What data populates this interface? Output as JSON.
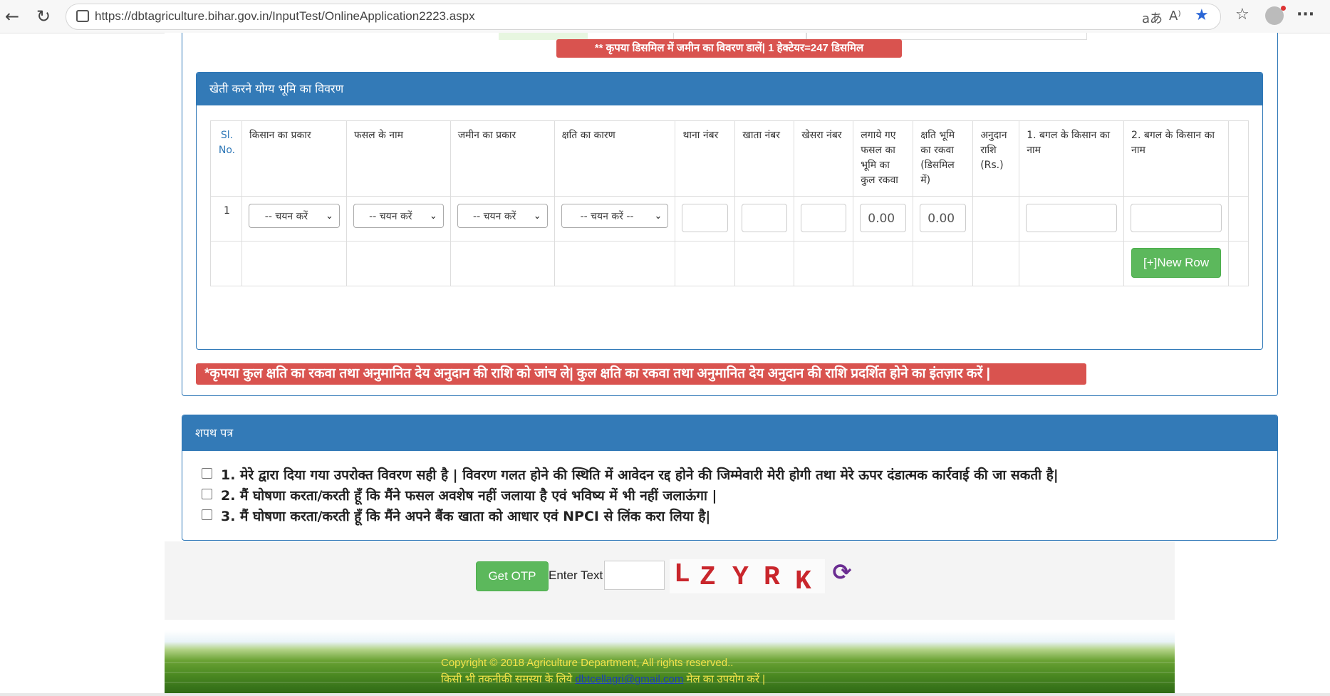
{
  "browser": {
    "url": "https://dbtagriculture.bihar.gov.in/InputTest/OnlineApplication2223.aspx",
    "back_glyph": "←",
    "reload_glyph": "↻",
    "translate_glyph": "aあ",
    "read_aloud_glyph": "A⁾",
    "favorite_glyph": "★",
    "favorites_glyph": "☆",
    "menu_glyph": "···"
  },
  "top_note": "** कृपया डिसमिल में जमीन का विवरण डालें| 1 हेक्टेयर=247 डिसमिल",
  "land_panel": {
    "title": "खेती करने योग्य भूमि का विवरण",
    "headers": [
      "Sl. No.",
      "किसान का प्रकार",
      "फसल के नाम",
      "जमीन का प्रकार",
      "क्षति का कारण",
      "थाना नंबर",
      "खाता नंबर",
      "खेसरा नंबर",
      "लगाये गए फसल का भूमि का कुल रकवा",
      "क्षति भूमि का रकवा (डिसमिल में)",
      "अनुदान राशि (Rs.)",
      "1. बगल के किसान का नाम",
      "2. बगल के किसान का नाम"
    ],
    "row": {
      "sl": "1",
      "farmer_type": "-- चयन करें",
      "crop_name": "-- चयन करें",
      "land_type": "-- चयन करें",
      "damage_reason": "-- चयन करें --",
      "thana_no": "",
      "khata_no": "",
      "khesra_no": "",
      "total_area": "0.00",
      "damaged_area": "0.00",
      "grant": "",
      "neighbor1": "",
      "neighbor2": ""
    },
    "chevron": "⌄",
    "new_row_label": "[+]New Row"
  },
  "check_note": "*कृपया कुल क्षति का रकवा तथा अनुमानित देय अनुदान की राशि को जांच ले| कुल क्षति का रकवा तथा अनुमानित देय अनुदान की राशि प्रदर्शित होने का इंतज़ार करें |",
  "oath": {
    "title": "शपथ पत्र",
    "items": [
      "1. मेरे द्वारा दिया गया उपरोक्त विवरण सही है | विवरण गलत होने की स्थिति में आवेदन रद्द होने की जिम्मेवारी मेरी होगी तथा मेरे ऊपर दंडात्मक कार्रवाई की जा सकती है|",
      "2. मैं घोषणा करता/करती हूँ कि मैंने फसल अवशेष नहीं जलाया है एवं भविष्य में भी नहीं जलाऊंगा |",
      "3. मैं घोषणा करता/करती हूँ कि मैंने अपने बैंक खाता को आधार एवं NPCI से लिंक करा लिया है|"
    ]
  },
  "otp": {
    "button_label": "Get OTP",
    "enter_text_label": "Enter Text",
    "input_value": "",
    "captcha_chars": [
      "L",
      "Z",
      "Y",
      "R",
      "K"
    ],
    "refresh_glyph": "⟳"
  },
  "footer": {
    "copyright": "Copyright © 2018 Agriculture Department, All rights reserved..",
    "contact_prefix": "किसी भी तकनीकी समस्या के लिये ",
    "email": "dbtcellagri@gmail.com",
    "contact_suffix": " मेल का उपयोग करें |"
  },
  "colors": {
    "panel_blue": "#337ab7",
    "alert_red": "#d9534f",
    "button_green": "#5cb85c",
    "captcha_red": "#c9262c",
    "refresh_purple": "#6a2c91"
  }
}
